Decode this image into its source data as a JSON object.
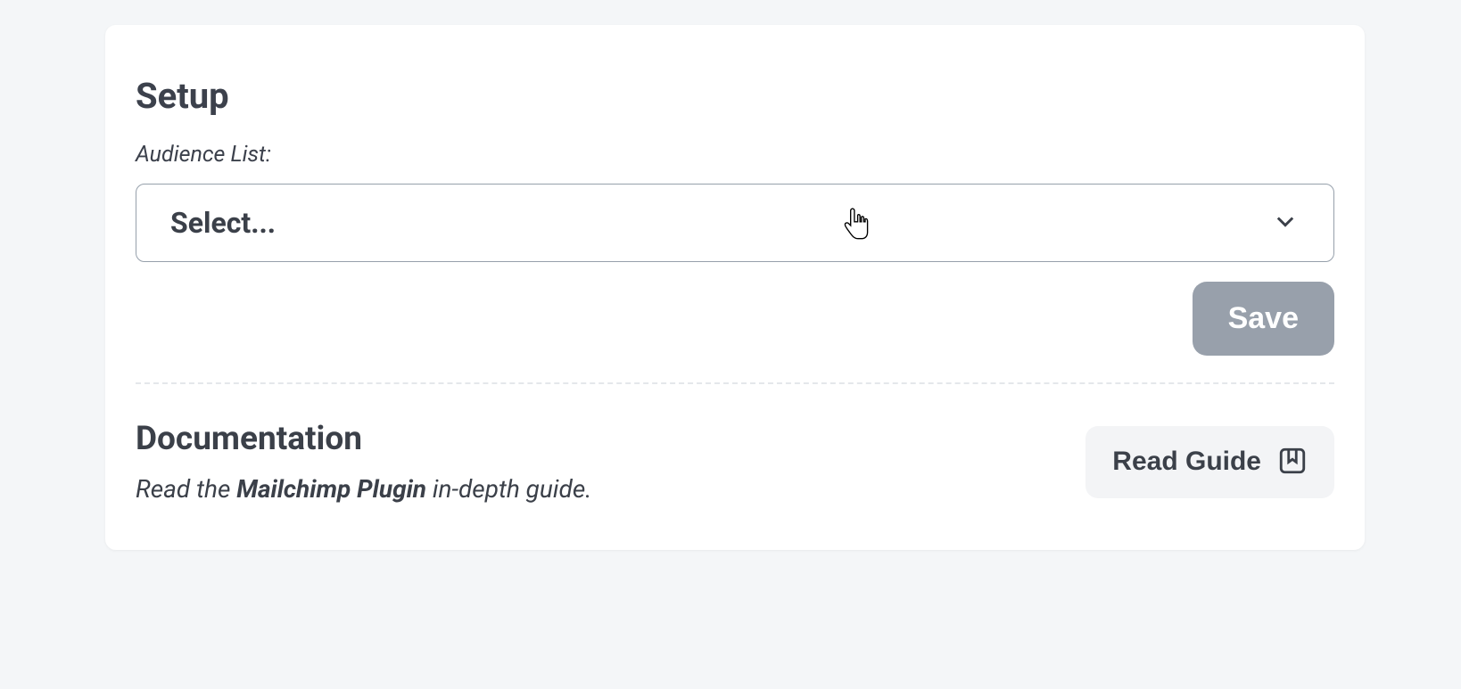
{
  "setup": {
    "title": "Setup",
    "audience_label": "Audience List:",
    "select_placeholder": "Select...",
    "save_label": "Save"
  },
  "documentation": {
    "title": "Documentation",
    "text_prefix": "Read the ",
    "text_bold": "Mailchimp Plugin",
    "text_suffix": " in-depth guide.",
    "read_guide_label": "Read Guide"
  }
}
